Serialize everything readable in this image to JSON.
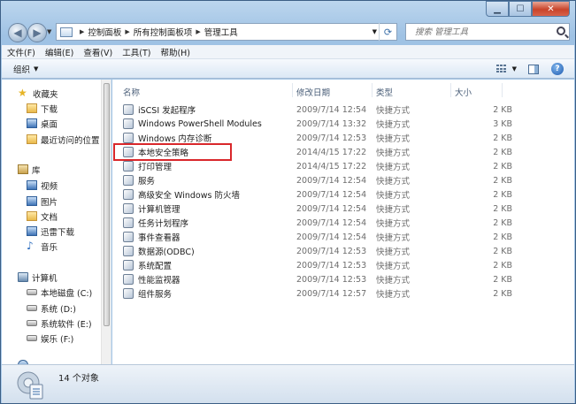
{
  "address": {
    "crumbs": [
      "控制面板",
      "所有控制面板项",
      "管理工具"
    ]
  },
  "search": {
    "placeholder": "搜索 管理工具"
  },
  "menu": [
    "文件(F)",
    "编辑(E)",
    "查看(V)",
    "工具(T)",
    "帮助(H)"
  ],
  "toolbar": {
    "organize": "组织"
  },
  "nav": {
    "favorites": {
      "label": "收藏夹",
      "icon": "star-icon",
      "items": [
        {
          "label": "下载",
          "icon": "downloads-folder-icon"
        },
        {
          "label": "桌面",
          "icon": "desktop-icon"
        },
        {
          "label": "最近访问的位置",
          "icon": "recent-places-icon"
        }
      ]
    },
    "libraries": {
      "label": "库",
      "icon": "library-icon",
      "items": [
        {
          "label": "视频",
          "icon": "videos-icon"
        },
        {
          "label": "图片",
          "icon": "pictures-icon"
        },
        {
          "label": "文档",
          "icon": "documents-icon"
        },
        {
          "label": "迅雷下载",
          "icon": "thunder-download-icon"
        },
        {
          "label": "音乐",
          "icon": "music-icon"
        }
      ]
    },
    "computer": {
      "label": "计算机",
      "icon": "computer-icon",
      "items": [
        {
          "label": "本地磁盘 (C:)",
          "icon": "drive-icon"
        },
        {
          "label": "系统 (D:)",
          "icon": "drive-icon"
        },
        {
          "label": "系统软件 (E:)",
          "icon": "drive-icon"
        },
        {
          "label": "娱乐 (F:)",
          "icon": "drive-icon"
        }
      ]
    }
  },
  "columns": {
    "name": "名称",
    "date": "修改日期",
    "type": "类型",
    "size": "大小"
  },
  "files": [
    {
      "name": "iSCSI 发起程序",
      "date": "2009/7/14 12:54",
      "type": "快捷方式",
      "size": "2 KB"
    },
    {
      "name": "Windows PowerShell Modules",
      "date": "2009/7/14 13:32",
      "type": "快捷方式",
      "size": "3 KB"
    },
    {
      "name": "Windows 内存诊断",
      "date": "2009/7/14 12:53",
      "type": "快捷方式",
      "size": "2 KB"
    },
    {
      "name": "本地安全策略",
      "date": "2014/4/15 17:22",
      "type": "快捷方式",
      "size": "2 KB"
    },
    {
      "name": "打印管理",
      "date": "2014/4/15 17:22",
      "type": "快捷方式",
      "size": "2 KB"
    },
    {
      "name": "服务",
      "date": "2009/7/14 12:54",
      "type": "快捷方式",
      "size": "2 KB"
    },
    {
      "name": "高级安全 Windows 防火墙",
      "date": "2009/7/14 12:54",
      "type": "快捷方式",
      "size": "2 KB"
    },
    {
      "name": "计算机管理",
      "date": "2009/7/14 12:54",
      "type": "快捷方式",
      "size": "2 KB"
    },
    {
      "name": "任务计划程序",
      "date": "2009/7/14 12:54",
      "type": "快捷方式",
      "size": "2 KB"
    },
    {
      "name": "事件查看器",
      "date": "2009/7/14 12:54",
      "type": "快捷方式",
      "size": "2 KB"
    },
    {
      "name": "数据源(ODBC)",
      "date": "2009/7/14 12:53",
      "type": "快捷方式",
      "size": "2 KB"
    },
    {
      "name": "系统配置",
      "date": "2009/7/14 12:53",
      "type": "快捷方式",
      "size": "2 KB"
    },
    {
      "name": "性能监视器",
      "date": "2009/7/14 12:53",
      "type": "快捷方式",
      "size": "2 KB"
    },
    {
      "name": "组件服务",
      "date": "2009/7/14 12:57",
      "type": "快捷方式",
      "size": "2 KB"
    }
  ],
  "status": {
    "count": "14 个对象"
  },
  "colors": {
    "highlight": "#d9272b",
    "frame": "#a9c9e8"
  }
}
